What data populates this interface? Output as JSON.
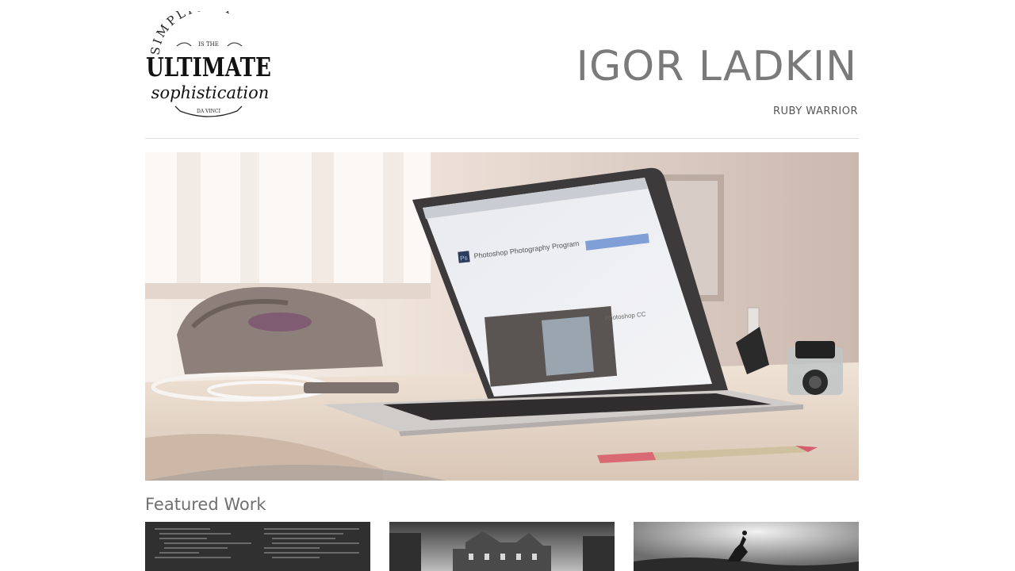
{
  "header": {
    "logo": {
      "line1": "SIMPLICITY",
      "line2": "IS THE",
      "line3": "ULTIMATE",
      "line4": "sophistication",
      "line5": "DA VINCI"
    },
    "title": "IGOR LADKIN",
    "subtitle": "RUBY WARRIOR"
  },
  "hero": {
    "screen_heading": "Photoshop Photography Program",
    "screen_app_badge": "Ps",
    "screen_product": "Photoshop CC"
  },
  "featured": {
    "heading": "Featured Work",
    "items": [
      {
        "icon": "code-screen-thumbnail"
      },
      {
        "icon": "castle-thumbnail"
      },
      {
        "icon": "surfer-thumbnail"
      }
    ]
  }
}
